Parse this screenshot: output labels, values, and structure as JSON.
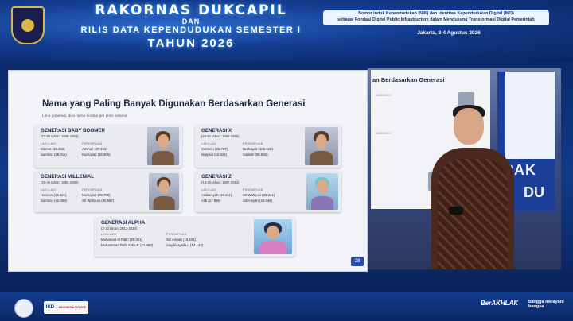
{
  "header": {
    "title": "RAKORNAS DUKCAPIL",
    "conjunction": "DAN",
    "subtitle": "RILIS DATA KEPENDUDUKAN SEMESTER I",
    "year": "TAHUN 2026",
    "topic_line1": "Nomor Induk Kependudukan (NIK) dan Identitas Kependudukan Digital (IKD)",
    "topic_line2": "sebagai Fondasi Digital Public Infrastructure dalam Mendukung Transformasi Digital Pemerintah",
    "place_date": "Jakarta, 3-4 Agustus 2026"
  },
  "slide": {
    "title": "Nama yang Paling Banyak Digunakan Berdasarkan Generasi",
    "subtitle": "Lima generasi, dua nama teratas per jenis kelamin",
    "page_number": "28",
    "col_male": "LAKI-LAKI",
    "col_female": "PEREMPUAN",
    "generations": [
      {
        "name": "GENERASI BABY BOOMER",
        "range": "(62-80 tahun: 1946-1964)",
        "male": [
          "Slamet (38.262)",
          "Sutrisno (28.311)"
        ],
        "female": [
          "Aminah (37.153)",
          "Nurhayati (36.900)"
        ]
      },
      {
        "name": "GENERASI X",
        "range": "(46-61 tahun: 1965-1980)",
        "male": [
          "Sutrisno (65.737)",
          "Mulyadi (52.325)"
        ],
        "female": [
          "Nurhayati (105.618)",
          "Sulastri (85.550)"
        ]
      },
      {
        "name": "GENERASI MILLENIAL",
        "range": "(30-45 tahun: 1981-1996)",
        "male": [
          "Hermon (44.421)",
          "Sutrisno (42.300)"
        ],
        "female": [
          "Nurhayati (89.799)",
          "Sri Wahyuni (80.567)"
        ]
      },
      {
        "name": "GENERASI Z",
        "range": "(14-29 tahun: 1997-2012)",
        "male": [
          "Ardiansyah (18.211)",
          "Aldi (17.996)"
        ],
        "female": [
          "Sri Wahyuni (26.341)",
          "Siti Aisyah (25.046)"
        ]
      },
      {
        "name": "GENERASI ALPHA",
        "range": "(2-13 tahun: 2013-2024)",
        "male": [
          "Muhamad Al Fatih (29.351)",
          "Muhammad Rafa Azka P. (11.468)"
        ],
        "female": [
          "Siti Aisyah (15.441)",
          "Aisyah Aysila I. (14.143)"
        ]
      }
    ]
  },
  "camera": {
    "screen_title": "an Berdasarkan Generasi",
    "screen_mini1": "GENERASI X",
    "screen_mini2": "GENERASI Z",
    "backdrop_text1": "RAK",
    "backdrop_text2": "DU"
  },
  "footer": {
    "ikd_label": "IKD",
    "ikd_tag": "INDONESIA FUTURE",
    "akhlak": "BerAKHLAK",
    "bangga": "bangga melayani bangsa"
  }
}
